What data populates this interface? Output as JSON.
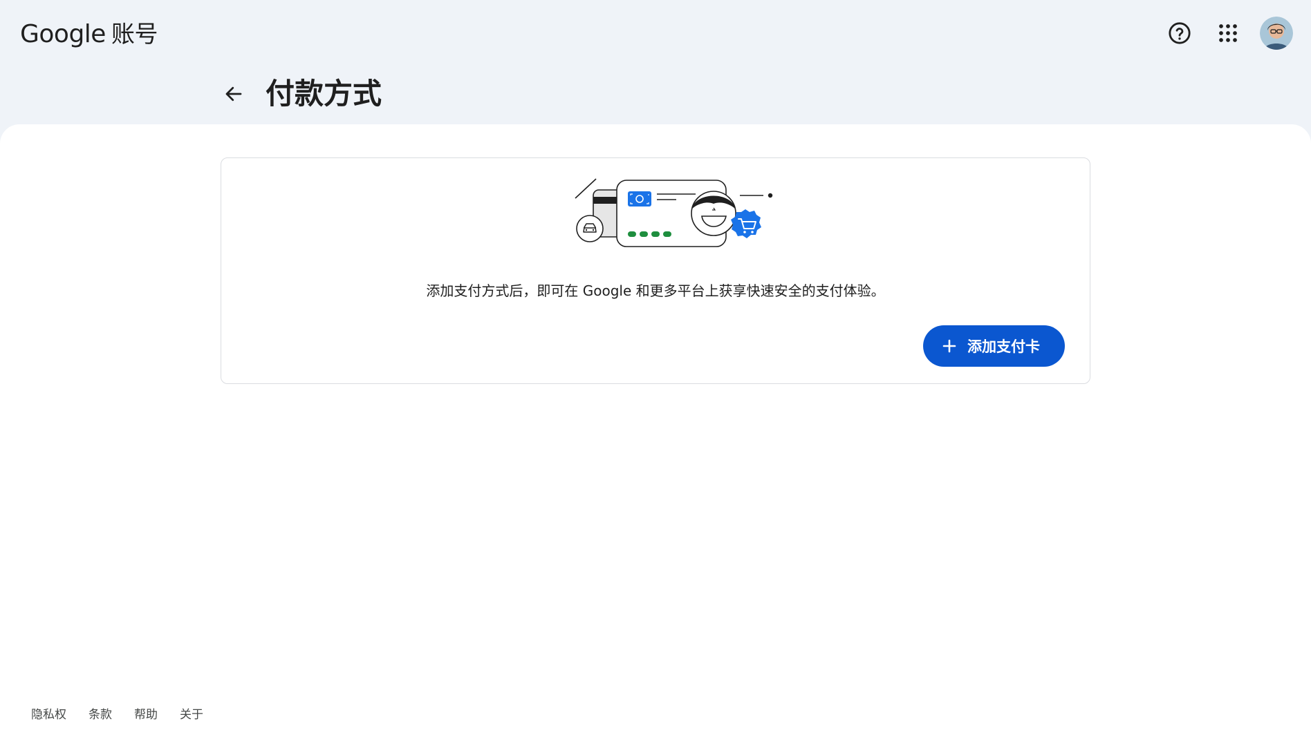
{
  "header": {
    "brand_logo_text": "Google",
    "brand_product": "账号",
    "help_icon": "help-circle-icon",
    "apps_icon": "apps-grid-icon",
    "avatar_icon": "user-avatar"
  },
  "page": {
    "back_icon": "arrow-left-icon",
    "title": "付款方式"
  },
  "card": {
    "illustration": "payment-methods-illustration",
    "description": "添加支付方式后，即可在 Google 和更多平台上获享快速安全的支付体验。",
    "add_button_label": "添加支付卡",
    "add_button_icon": "plus-icon"
  },
  "footer": {
    "links": [
      "隐私权",
      "条款",
      "帮助",
      "关于"
    ]
  },
  "colors": {
    "background": "#eff3f8",
    "surface": "#ffffff",
    "primary": "#0b57d0",
    "accent_green": "#1e8e3e",
    "text": "#1f1f1f"
  }
}
